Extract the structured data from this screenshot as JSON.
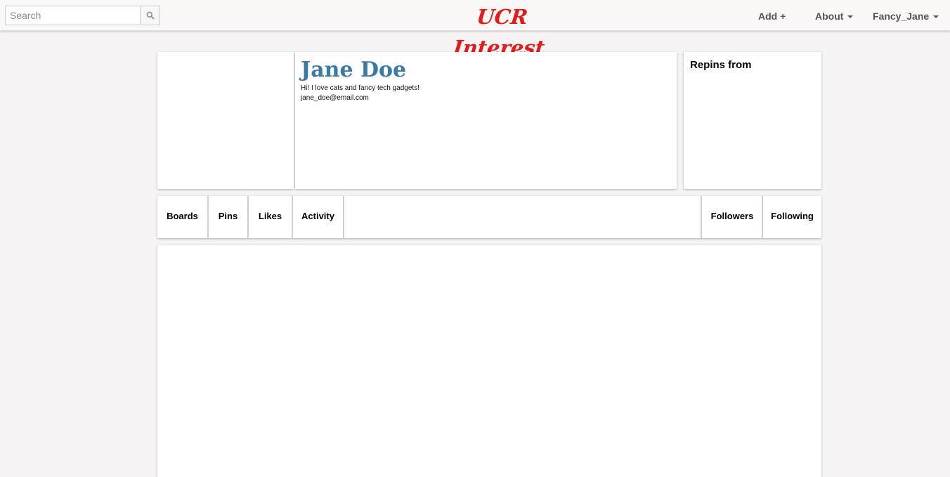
{
  "header": {
    "search_placeholder": "Search",
    "logo": "UCR Interest",
    "nav": {
      "add": "Add +",
      "about": "About",
      "user": "Fancy_Jane"
    }
  },
  "profile": {
    "name": "Jane Doe",
    "bio": "Hi! I love cats and fancy tech gadgets!",
    "email": "jane_doe@email.com"
  },
  "repins": {
    "title": "Repins from"
  },
  "tabs": {
    "left": [
      "Boards",
      "Pins",
      "Likes",
      "Activity"
    ],
    "right": [
      "Followers",
      "Following"
    ]
  },
  "colors": {
    "logo": "#e21b1b",
    "name": "#3b7aa5",
    "background": "#f5f3f3"
  }
}
